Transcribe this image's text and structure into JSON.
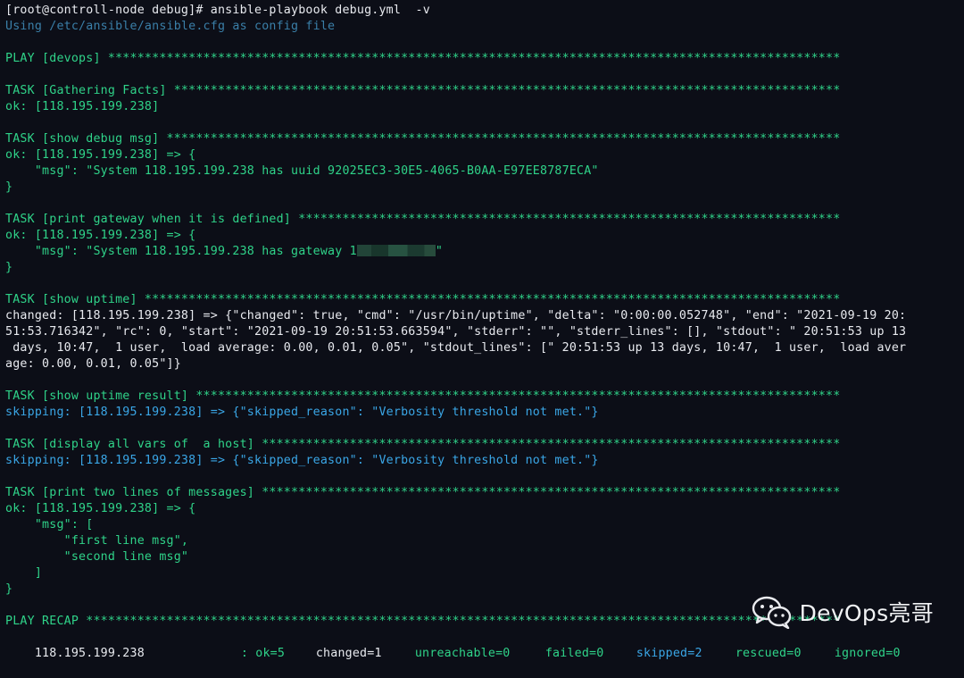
{
  "lines": [
    {
      "t": "[root@controll-node debug]# ansible-playbook debug.yml  -v",
      "c": "w"
    },
    {
      "t": "Using /etc/ansible/ansible.cfg as config file",
      "c": "dim"
    },
    {
      "t": "",
      "c": "w"
    },
    {
      "t": "PLAY [devops] ****************************************************************************************************",
      "c": "g"
    },
    {
      "t": "",
      "c": "w"
    },
    {
      "t": "TASK [Gathering Facts] *******************************************************************************************",
      "c": "g"
    },
    {
      "t": "ok: [118.195.199.238]",
      "c": "g"
    },
    {
      "t": "",
      "c": "w"
    },
    {
      "t": "TASK [show debug msg] ********************************************************************************************",
      "c": "g"
    },
    {
      "t": "ok: [118.195.199.238] => {",
      "c": "g"
    },
    {
      "t": "    \"msg\": \"System 118.195.199.238 has uuid 92025EC3-30E5-4065-B0AA-E97EE8787ECA\"",
      "c": "g"
    },
    {
      "t": "}",
      "c": "g"
    },
    {
      "t": "",
      "c": "w"
    },
    {
      "t": "TASK [print gateway when it is defined] **************************************************************************",
      "c": "g"
    },
    {
      "t": "ok: [118.195.199.238] => {",
      "c": "g"
    },
    {
      "t": "    \"msg\": \"System 118.195.199.238 has gateway 1",
      "c": "g",
      "blur": true,
      "after": "\""
    },
    {
      "t": "}",
      "c": "g"
    },
    {
      "t": "",
      "c": "w"
    },
    {
      "t": "TASK [show uptime] ***********************************************************************************************",
      "c": "g"
    },
    {
      "t": "changed: [118.195.199.238] => {\"changed\": true, \"cmd\": \"/usr/bin/uptime\", \"delta\": \"0:00:00.052748\", \"end\": \"2021-09-19 20:",
      "c": "w"
    },
    {
      "t": "51:53.716342\", \"rc\": 0, \"start\": \"2021-09-19 20:51:53.663594\", \"stderr\": \"\", \"stderr_lines\": [], \"stdout\": \" 20:51:53 up 13",
      "c": "w"
    },
    {
      "t": " days, 10:47,  1 user,  load average: 0.00, 0.01, 0.05\", \"stdout_lines\": [\" 20:51:53 up 13 days, 10:47,  1 user,  load aver",
      "c": "w"
    },
    {
      "t": "age: 0.00, 0.01, 0.05\"]}",
      "c": "w"
    },
    {
      "t": "",
      "c": "w"
    },
    {
      "t": "TASK [show uptime result] ****************************************************************************************",
      "c": "g"
    },
    {
      "t": "skipping: [118.195.199.238] => {\"skipped_reason\": \"Verbosity threshold not met.\"}",
      "c": "b"
    },
    {
      "t": "",
      "c": "w"
    },
    {
      "t": "TASK [display all vars of  a host] *******************************************************************************",
      "c": "g"
    },
    {
      "t": "skipping: [118.195.199.238] => {\"skipped_reason\": \"Verbosity threshold not met.\"}",
      "c": "b"
    },
    {
      "t": "",
      "c": "w"
    },
    {
      "t": "TASK [print two lines of messages] *******************************************************************************",
      "c": "g"
    },
    {
      "t": "ok: [118.195.199.238] => {",
      "c": "g"
    },
    {
      "t": "    \"msg\": [",
      "c": "g"
    },
    {
      "t": "        \"first line msg\",",
      "c": "g"
    },
    {
      "t": "        \"second line msg\"",
      "c": "g"
    },
    {
      "t": "    ]",
      "c": "g"
    },
    {
      "t": "}",
      "c": "g"
    },
    {
      "t": "",
      "c": "w"
    },
    {
      "t": "PLAY RECAP *******************************************************************************************************",
      "c": "g"
    }
  ],
  "recap": {
    "host": "118.195.199.238",
    "ok": ": ok=5",
    "changed": "changed=1",
    "unreachable": "unreachable=0",
    "failed": "failed=0",
    "skipped": "skipped=2",
    "rescued": "rescued=0",
    "ignored": "ignored=0"
  },
  "watermark": {
    "text": "DevOps亮哥",
    "icon": "wechat-icon"
  },
  "colors": {
    "background": "#0c0e17",
    "green": "#2fd389",
    "white": "#e8eaef",
    "blue": "#3aa6e6",
    "dim": "#3a7fa8"
  }
}
